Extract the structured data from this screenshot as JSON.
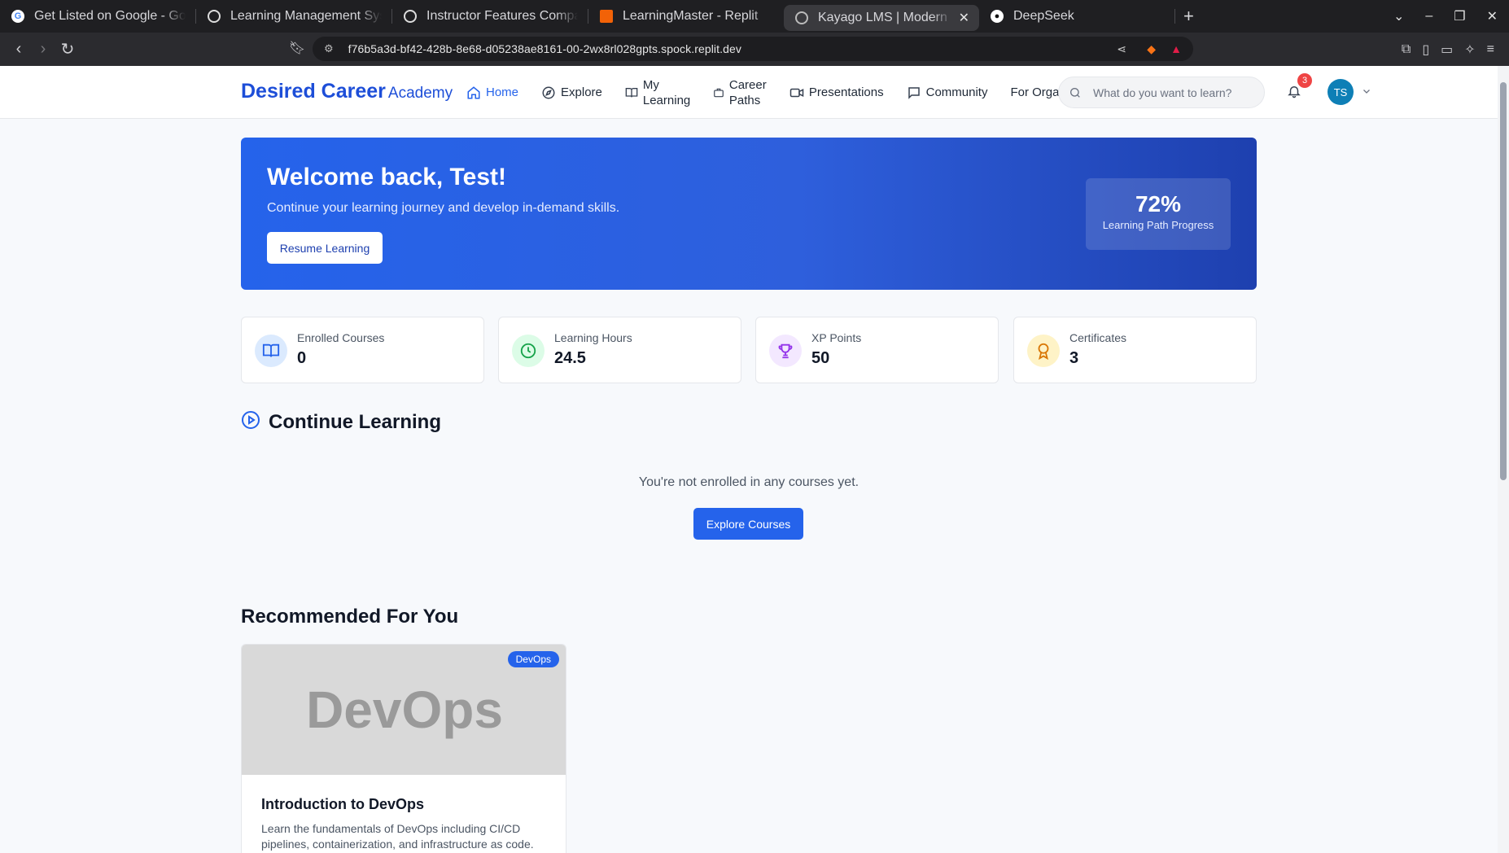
{
  "browser": {
    "tabs": [
      {
        "title": "Get Listed on Google - Goog",
        "favicon": "google-icon",
        "active": false
      },
      {
        "title": "Learning Management Syste",
        "favicon": "openai-icon",
        "active": false
      },
      {
        "title": "Instructor Features Compari",
        "favicon": "openai-icon",
        "active": false
      },
      {
        "title": "LearningMaster - Replit",
        "favicon": "replit-icon",
        "active": false
      },
      {
        "title": "Kayago LMS | Modern Le",
        "favicon": "globe-icon",
        "active": true
      },
      {
        "title": "DeepSeek",
        "favicon": "github-icon",
        "active": false
      }
    ],
    "url": "f76b5a3d-bf42-428b-8e68-d05238ae8161-00-2wx8rl028gpts.spock.replit.dev"
  },
  "header": {
    "logo_main": "Desired Career",
    "logo_sub": "Academy",
    "nav": [
      {
        "label": "Home",
        "icon": "home-icon"
      },
      {
        "label": "Explore",
        "icon": "compass-icon"
      },
      {
        "label": "My Learning",
        "icon": "book-icon"
      },
      {
        "label": "Career Paths",
        "icon": "briefcase-icon"
      },
      {
        "label": "Presentations",
        "icon": "video-icon"
      },
      {
        "label": "Community",
        "icon": "chat-icon"
      },
      {
        "label": "For Organ",
        "icon": ""
      }
    ],
    "search_placeholder": "What do you want to learn?",
    "notification_count": "3",
    "avatar_initials": "TS"
  },
  "hero": {
    "title": "Welcome back, Test!",
    "subtitle": "Continue your learning journey and develop in-demand skills.",
    "button": "Resume Learning",
    "progress_value": "72%",
    "progress_label": "Learning Path Progress"
  },
  "stats": [
    {
      "label": "Enrolled Courses",
      "value": "0",
      "icon": "book-open-icon",
      "color": "#2563eb",
      "bg": "#dbeafe"
    },
    {
      "label": "Learning Hours",
      "value": "24.5",
      "icon": "clock-icon",
      "color": "#16a34a",
      "bg": "#dcfce7"
    },
    {
      "label": "XP Points",
      "value": "50",
      "icon": "trophy-icon",
      "color": "#9333ea",
      "bg": "#f3e8ff"
    },
    {
      "label": "Certificates",
      "value": "3",
      "icon": "award-icon",
      "color": "#d97706",
      "bg": "#fef3c7"
    }
  ],
  "continue": {
    "title": "Continue Learning",
    "empty_text": "You're not enrolled in any courses yet.",
    "button": "Explore Courses"
  },
  "recommended": {
    "title": "Recommended For You",
    "courses": [
      {
        "thumb_text": "DevOps",
        "tag": "DevOps",
        "title": "Introduction to DevOps",
        "description": "Learn the fundamentals of DevOps including CI/CD pipelines, containerization, and infrastructure as code."
      }
    ]
  },
  "colors": {
    "accent": "#2563eb",
    "hero_dark": "#1e40af"
  }
}
